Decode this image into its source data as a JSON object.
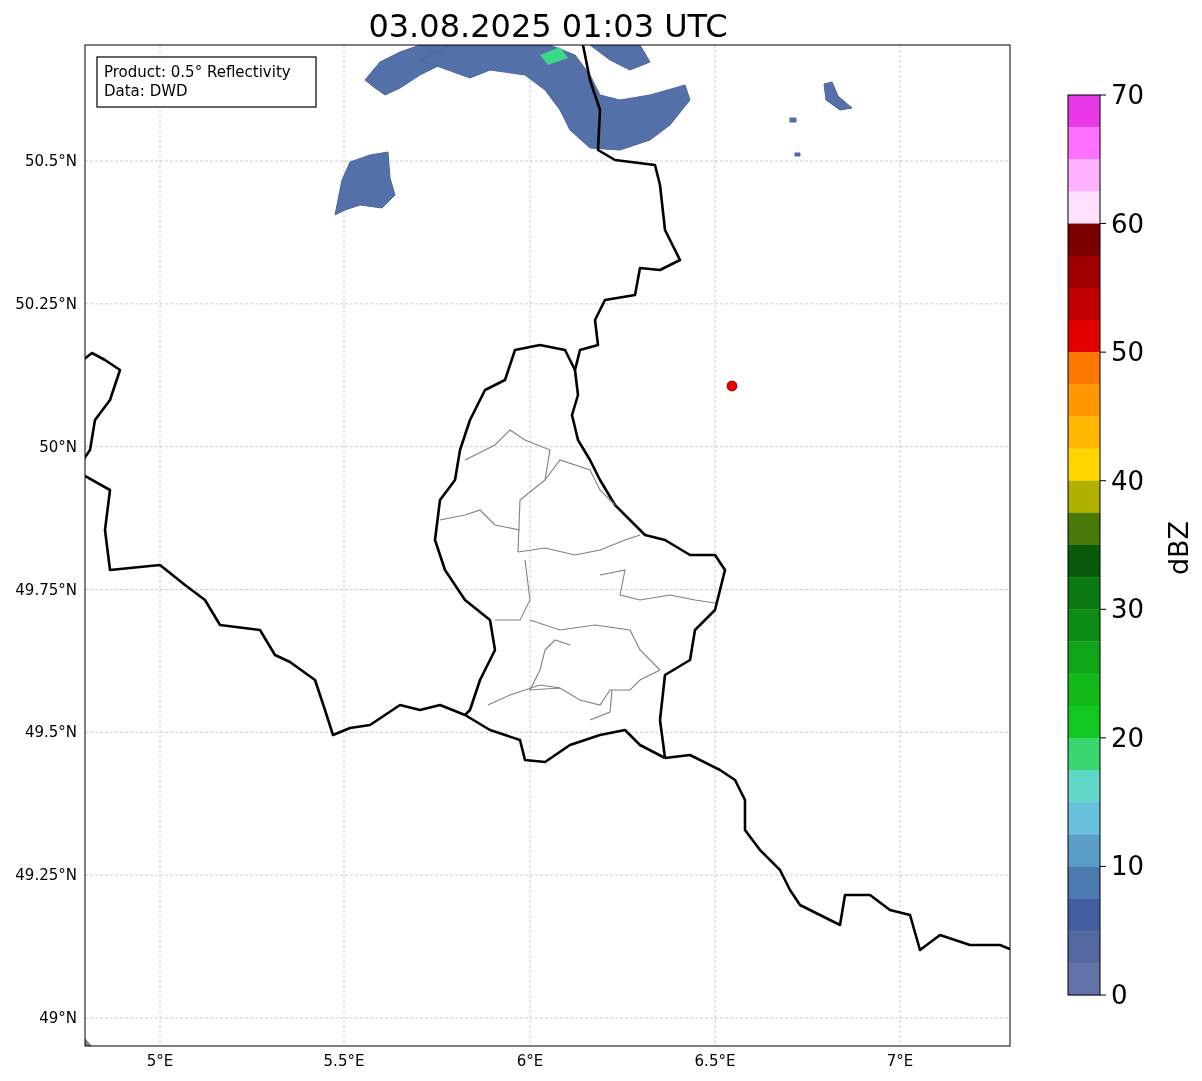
{
  "title": "03.08.2025 01:03 UTC",
  "legend": {
    "lines": [
      "Product: 0.5° Reflectivity",
      "Data: DWD"
    ]
  },
  "map": {
    "yticks": [
      "50.5°N",
      "50.25°N",
      "50°N",
      "49.75°N",
      "49.5°N",
      "49.25°N",
      "49°N"
    ],
    "xticks": [
      "5°E",
      "5.5°E",
      "6°E",
      "6.5°E",
      "7°E"
    ]
  },
  "colorbar": {
    "label": "dBZ",
    "ticks": [
      "70",
      "60",
      "50",
      "40",
      "30",
      "20",
      "10",
      "0"
    ],
    "bands": [
      {
        "color": "#e838e8"
      },
      {
        "color": "#ff70ff"
      },
      {
        "color": "#ffb0ff"
      },
      {
        "color": "#ffe0ff"
      },
      {
        "color": "#7a0000"
      },
      {
        "color": "#a00000"
      },
      {
        "color": "#c00000"
      },
      {
        "color": "#e00000"
      },
      {
        "color": "#ff7800"
      },
      {
        "color": "#ff9800"
      },
      {
        "color": "#ffb800"
      },
      {
        "color": "#ffd700"
      },
      {
        "color": "#b0b000"
      },
      {
        "color": "#4a7a0a"
      },
      {
        "color": "#085a0c"
      },
      {
        "color": "#0a7a10"
      },
      {
        "color": "#0c8c14"
      },
      {
        "color": "#10a418"
      },
      {
        "color": "#10b818"
      },
      {
        "color": "#10c820"
      },
      {
        "color": "#3cd670"
      },
      {
        "color": "#60d8c8"
      },
      {
        "color": "#68c0dc"
      },
      {
        "color": "#5a9ec8"
      },
      {
        "color": "#4a7ab0"
      },
      {
        "color": "#425ea0"
      },
      {
        "color": "#5468a0"
      },
      {
        "color": "#6272a8"
      }
    ]
  }
}
